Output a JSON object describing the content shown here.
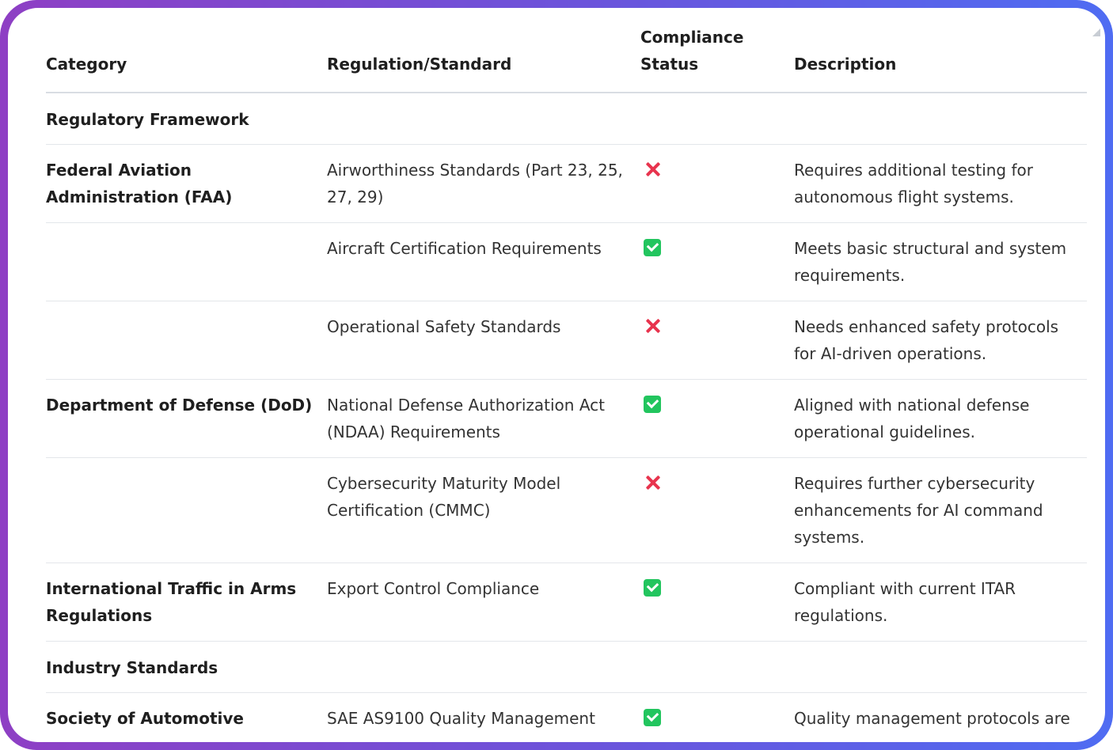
{
  "headers": {
    "category": "Category",
    "regulation": "Regulation/Standard",
    "status": "Compliance Status",
    "description": "Description"
  },
  "rows": [
    {
      "type": "section",
      "category": "Regulatory Framework"
    },
    {
      "type": "item",
      "category": "Federal Aviation Administration (FAA)",
      "regulation": "Airworthiness Standards (Part 23, 25, 27, 29)",
      "status": "non-compliant",
      "description": "Requires additional testing for autonomous flight systems."
    },
    {
      "type": "item",
      "category": "",
      "regulation": "Aircraft Certification Requirements",
      "status": "compliant",
      "description": "Meets basic structural and system requirements."
    },
    {
      "type": "item",
      "category": "",
      "regulation": "Operational Safety Standards",
      "status": "non-compliant",
      "description": "Needs enhanced safety protocols for AI-driven operations."
    },
    {
      "type": "item",
      "category": "Department of Defense (DoD)",
      "regulation": "National Defense Authorization Act (NDAA) Requirements",
      "status": "compliant",
      "description": "Aligned with national defense operational guidelines."
    },
    {
      "type": "item",
      "category": "",
      "regulation": "Cybersecurity Maturity Model Certification (CMMC)",
      "status": "non-compliant",
      "description": "Requires further cybersecurity enhancements for AI command systems."
    },
    {
      "type": "item",
      "category": "International Traffic in Arms Regulations",
      "regulation": "Export Control Compliance",
      "status": "compliant",
      "description": "Compliant with current ITAR regulations."
    },
    {
      "type": "section",
      "category": "Industry Standards"
    },
    {
      "type": "item",
      "category": "Society of Automotive",
      "regulation": "SAE AS9100 Quality Management",
      "status": "compliant",
      "description": "Quality management protocols are"
    }
  ],
  "icons": {
    "compliant": "check-box-icon",
    "non-compliant": "cross-icon"
  },
  "colors": {
    "compliant": "#22c55e",
    "non_compliant": "#e8344e",
    "frame_gradient_start": "#8e3fc4",
    "frame_gradient_end": "#4f6cf2"
  }
}
